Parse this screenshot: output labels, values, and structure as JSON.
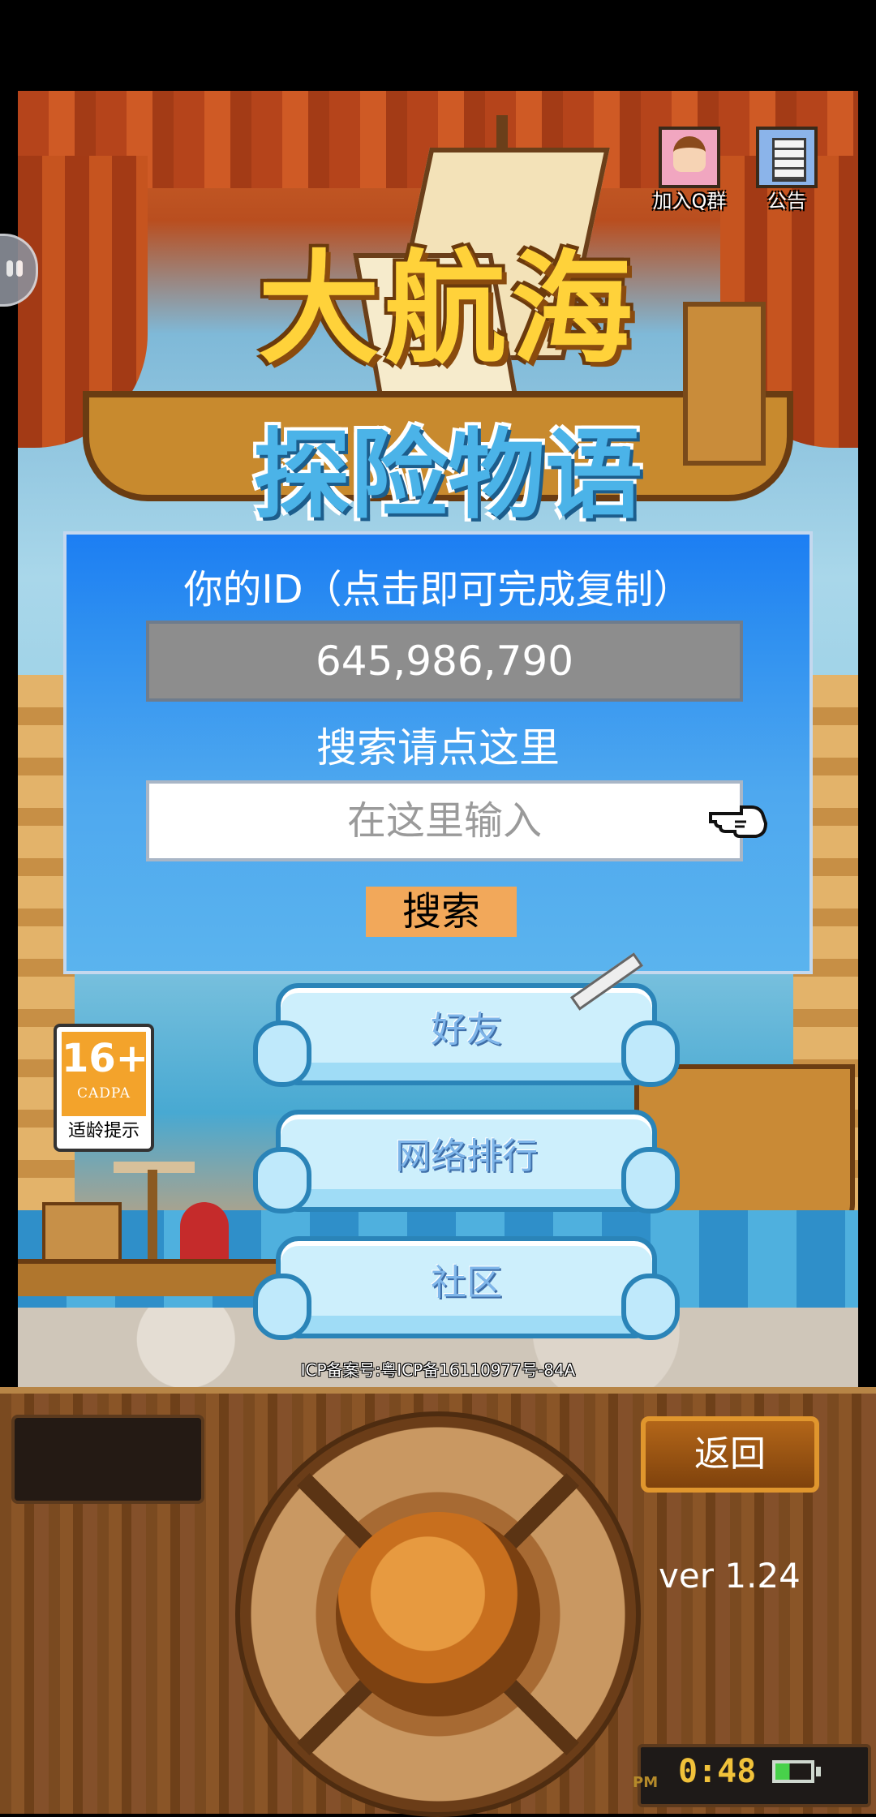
{
  "top_icons": {
    "qq_group_label": "加入Q群",
    "notice_label": "公告"
  },
  "logo": {
    "line1": "大航海",
    "line2": "探险物语"
  },
  "id_panel": {
    "title": "你的ID（点击即可完成复制）",
    "id_value": "645,986,790",
    "search_hint": "搜索请点这里",
    "search_placeholder": "在这里输入",
    "search_button": "搜索"
  },
  "menu": {
    "friends": "好友",
    "ranking": "网络排行",
    "community": "社区"
  },
  "age_rating": {
    "age": "16+",
    "org": "CADPA",
    "label": "适龄提示"
  },
  "icp": "ICP备案号:粤ICP备16110977号-84A",
  "console": {
    "back_button": "返回",
    "version": "ver 1.24",
    "clock_suffix": "PM",
    "clock_time": "0:48"
  },
  "colors": {
    "panel_blue": "#2f90f0",
    "search_button": "#f2a85a",
    "cloud_border": "#2a84b8",
    "clock_text": "#f1c23a"
  }
}
